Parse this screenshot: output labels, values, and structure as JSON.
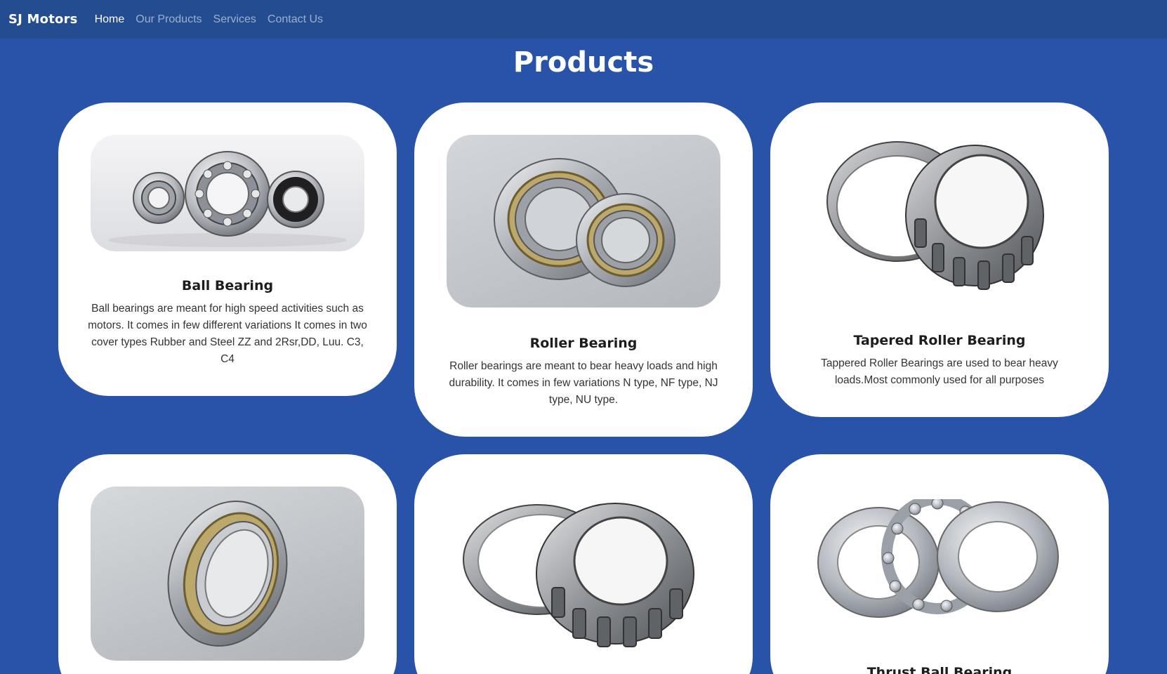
{
  "navbar": {
    "brand": "SJ Motors",
    "links": [
      "Home",
      "Our Products",
      "Services",
      "Contact Us"
    ],
    "active": "Home"
  },
  "page": {
    "title": "Products"
  },
  "products": [
    {
      "name": "Ball Bearing",
      "description": "Ball bearings are meant for high speed activities such as motors. It comes in few different variations It comes in two cover types Rubber and Steel ZZ and 2Rsr,DD, Luu. C3, C4",
      "image_icon": "ball-bearing-icon"
    },
    {
      "name": "Roller Bearing",
      "description": "Roller bearings are meant to bear heavy loads and high durability. It comes in few variations N type, NF type, NJ type, NU type.",
      "image_icon": "roller-bearing-icon"
    },
    {
      "name": "Tapered Roller Bearing",
      "description": "Tappered Roller Bearings are used to bear heavy loads.Most commonly used for all purposes",
      "image_icon": "tapered-roller-bearing-icon"
    },
    {
      "name": "",
      "description": "",
      "image_icon": "spherical-roller-bearing-icon"
    },
    {
      "name": "",
      "description": "",
      "image_icon": "thrust-roller-bearing-icon"
    },
    {
      "name": "Thrust Ball Bearing",
      "description": "",
      "image_icon": "thrust-ball-bearing-icon"
    }
  ],
  "colors": {
    "background": "#2953a8",
    "navbar": "#234c91",
    "card": "#ffffff"
  }
}
